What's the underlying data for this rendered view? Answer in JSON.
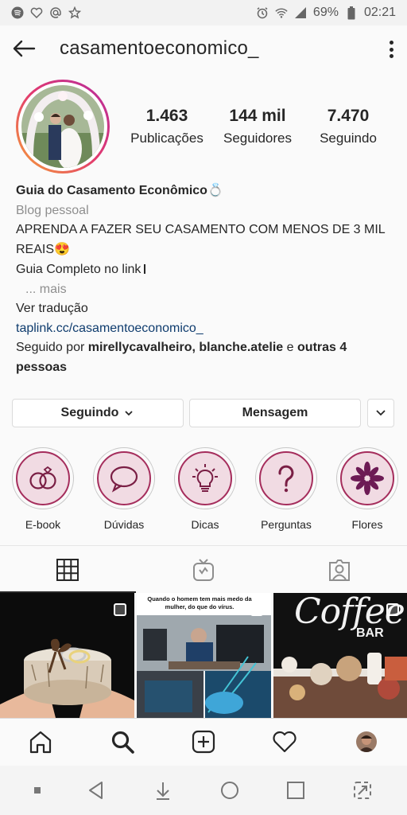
{
  "status_bar": {
    "battery": "69%",
    "time": "02:21"
  },
  "header": {
    "username": "casamentoeconomico_"
  },
  "stats": [
    {
      "value": "1.463",
      "label": "Publicações"
    },
    {
      "value": "144 mil",
      "label": "Seguidores"
    },
    {
      "value": "7.470",
      "label": "Seguindo"
    }
  ],
  "bio": {
    "name": "Guia do Casamento Econômico",
    "name_emoji": "💍",
    "category": "Blog pessoal",
    "line1": "APRENDA A FAZER SEU CASAMENTO COM MENOS DE 3 MIL REAIS",
    "line1_emoji": "😍",
    "line2": "Guia Completo no link",
    "more": "... mais",
    "translate": "Ver tradução",
    "link": "taplink.cc/casamentoeconomico_",
    "followed_by_prefix": "Seguido por",
    "followed_by_names": "mirellycavalheiro, blanche.atelie",
    "followed_by_and": "e",
    "followed_by_others": "outras 4 pessoas"
  },
  "buttons": {
    "following": "Seguindo",
    "message": "Mensagem"
  },
  "highlights": [
    {
      "label": "E-book",
      "icon": "rings-icon"
    },
    {
      "label": "Dúvidas",
      "icon": "speech-bubble-icon"
    },
    {
      "label": "Dicas",
      "icon": "lightbulb-icon"
    },
    {
      "label": "Perguntas",
      "icon": "question-mark-icon"
    },
    {
      "label": "Flores",
      "icon": "flower-icon"
    }
  ],
  "grid": {
    "post2_caption": "Quando o homem tem mais medo da mulher, do que do vírus.",
    "post3_caption_top": "Coffee",
    "post3_caption_bottom": "BAR"
  },
  "colors": {
    "highlight_accent": "#a52d5c",
    "link": "#0f3c6e",
    "avatar_gradient_start": "#f6a336",
    "avatar_gradient_end": "#b52c9e"
  }
}
